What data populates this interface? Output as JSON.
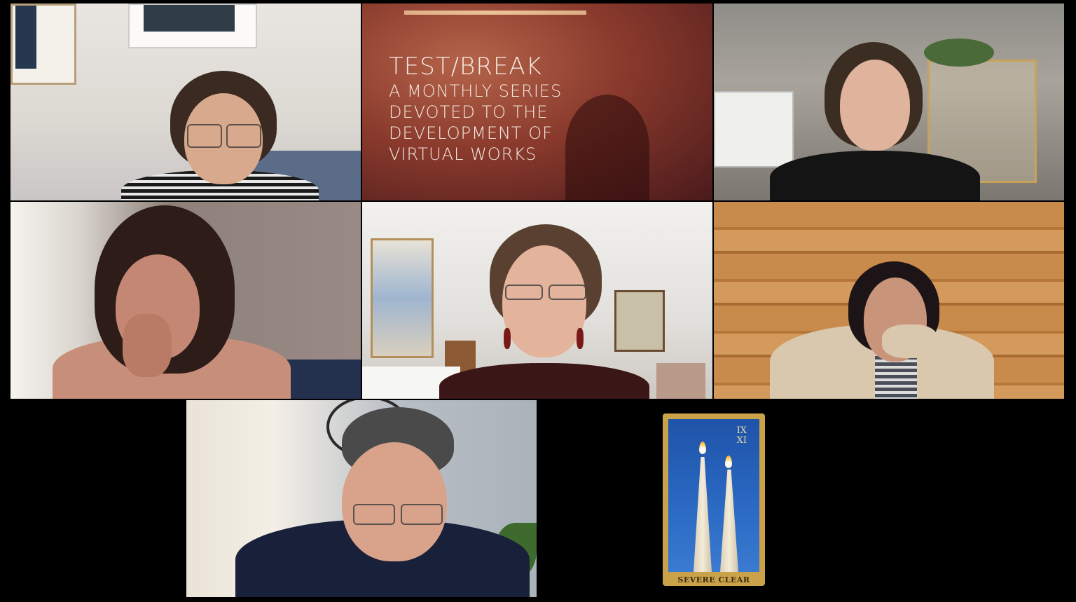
{
  "participants": [
    {
      "id": "p1",
      "description": "woman with glasses, striped shirt"
    },
    {
      "id": "p2",
      "description": "title card"
    },
    {
      "id": "p3",
      "description": "woman in black blazer"
    },
    {
      "id": "p4",
      "description": "woman with hand near face"
    },
    {
      "id": "p5",
      "description": "woman with glasses and red earrings"
    },
    {
      "id": "p6",
      "description": "woman in front of wood wall"
    },
    {
      "id": "p7",
      "description": "man with glasses"
    },
    {
      "id": "p8",
      "description": "tarot card image"
    }
  ],
  "title_card": {
    "headline": "TEST/BREAK",
    "line1": "A MONTHLY SERIES",
    "line2": "DEVOTED TO THE",
    "line3": "DEVELOPMENT OF",
    "line4": "VIRTUAL WORKS"
  },
  "tarot_card": {
    "numeral_top": "IX",
    "numeral_bottom": "XI",
    "label": "SEVERE CLEAR",
    "border_color": "#caa24a",
    "sky_color": "#2a68c2"
  },
  "colors": {
    "background": "#000000"
  }
}
